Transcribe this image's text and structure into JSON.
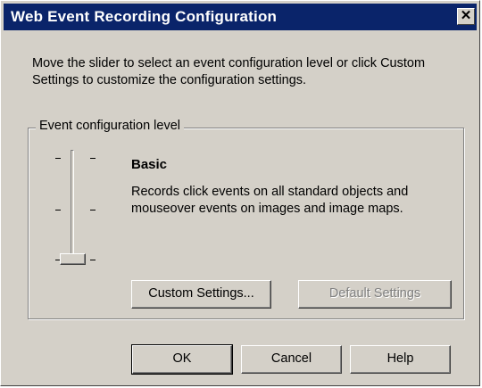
{
  "window": {
    "title": "Web Event Recording Configuration",
    "close_glyph": "✕"
  },
  "description": "Move the slider to select an event configuration level or click Custom Settings to customize the configuration settings.",
  "group": {
    "legend": "Event configuration level",
    "level_title": "Basic",
    "level_description": "Records click events on all standard objects and mouseover events on images and image maps.",
    "slider": {
      "positions": 3,
      "selected_level": "Basic"
    }
  },
  "buttons": {
    "custom_settings": "Custom Settings...",
    "default_settings": "Default Settings",
    "ok": "OK",
    "cancel": "Cancel",
    "help": "Help"
  },
  "colors": {
    "titlebar": "#0a246a",
    "face": "#d4d0c8"
  }
}
